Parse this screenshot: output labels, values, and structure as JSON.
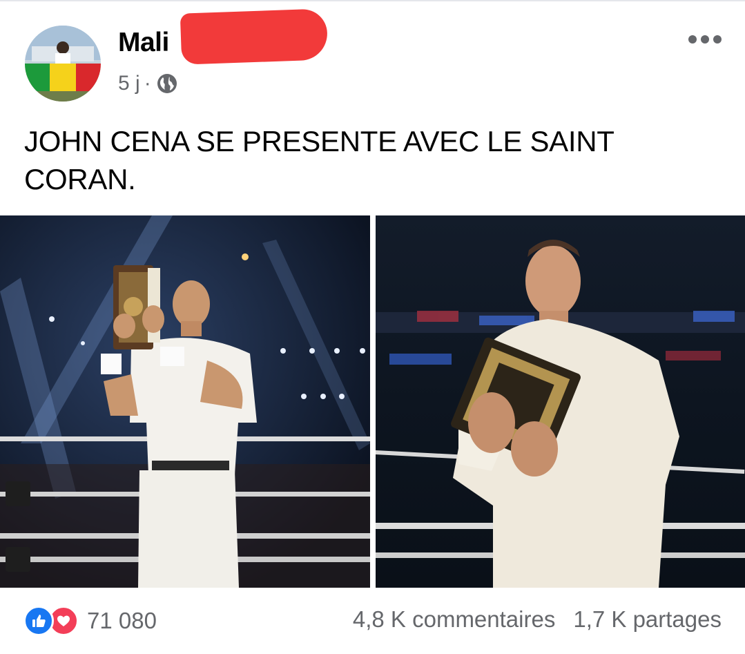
{
  "post": {
    "author": "Mali",
    "time": "5 j",
    "separator": "·",
    "text": "JOHN CENA SE PRESENTE AVEC LE SAINT CORAN."
  },
  "photos": [
    {
      "alt_icon": "wrestler-holding-book-photo-left"
    },
    {
      "alt_icon": "wrestler-holding-book-photo-right"
    }
  ],
  "footer": {
    "reaction_count": "71 080",
    "comments": "4,8 K commentaires",
    "shares": "1,7 K partages"
  },
  "colors": {
    "like": "#1877f2",
    "love": "#f33e58",
    "meta_gray": "#65676b",
    "redaction": "#f23a3a"
  }
}
